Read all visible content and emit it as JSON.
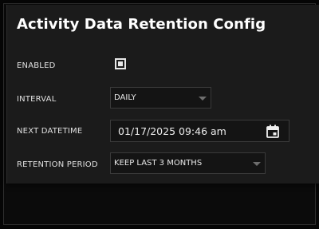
{
  "dialog": {
    "title": "Activity Data Retention Config"
  },
  "fields": {
    "enabled": {
      "label": "ENABLED",
      "checked": true
    },
    "interval": {
      "label": "INTERVAL",
      "value": "DAILY"
    },
    "next_datetime": {
      "label": "NEXT DATETIME",
      "value": "01/17/2025 09:46 am"
    },
    "retention_period": {
      "label": "RETENTION PERIOD",
      "value": "KEEP LAST 3 MONTHS"
    }
  },
  "icons": {
    "calendar": "calendar-icon",
    "dropdown": "chevron-down-icon"
  }
}
